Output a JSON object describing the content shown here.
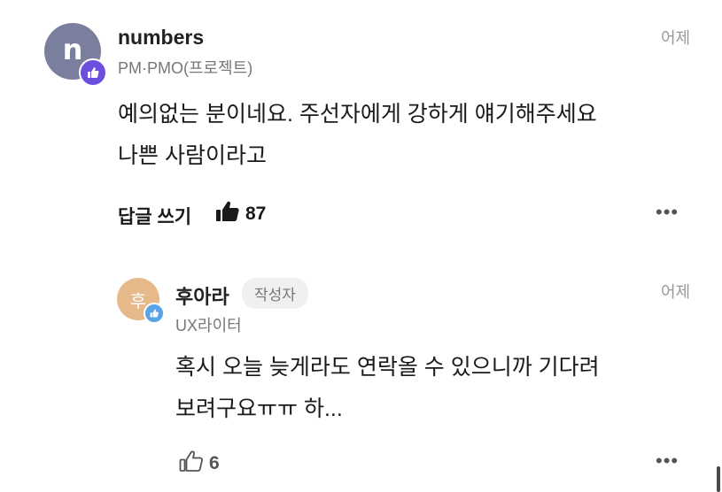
{
  "comment": {
    "avatar_letter": "n",
    "avatar_color": "#7b7f9e",
    "badge_icon": "thumbs-up-icon",
    "badge_color": "#6d4fe0",
    "author": "numbers",
    "role": "PM·PMO(프로젝트)",
    "time": "어제",
    "lines": [
      "예의없는 분이네요. 주선자에게 강하게 얘기해주세요",
      "나쁜 사람이라고"
    ],
    "reply_label": "답글 쓰기",
    "like_icon": "thumbs-up-filled-icon",
    "like_count": "87",
    "more_label": "•••"
  },
  "reply": {
    "avatar_letter": "후",
    "avatar_color": "#e6b98a",
    "badge_icon": "thumbs-up-icon",
    "badge_color": "#5aa4e6",
    "author": "후아라",
    "author_badge": "작성자",
    "role": "UX라이터",
    "time": "어제",
    "lines": [
      "혹시 오늘 늦게라도 연락올 수 있으니까 기다려",
      "보려구요ㅠㅠ 하..."
    ],
    "like_icon": "thumbs-up-outline-icon",
    "like_count": "6",
    "more_label": "•••"
  }
}
